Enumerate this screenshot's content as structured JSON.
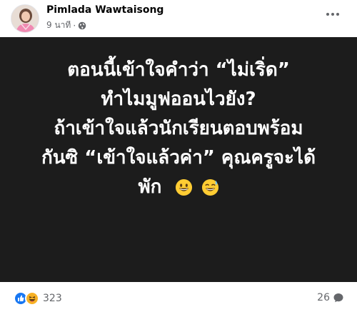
{
  "post": {
    "author": "Pimlada Wawtaisong",
    "time": "9 นาที",
    "separator": "·",
    "audience_icon": "globe-icon",
    "more_icon": "more-options-icon"
  },
  "image_text": {
    "lines": [
      "ตอนนี้เข้าใจคำว่า “ไม่เริ่ด”",
      "ทำไมมูฟออนไวยัง?",
      "ถ้าเข้าใจแล้วนักเรียนตอบพร้อม",
      "กันซิ “เข้าใจแล้วค่า” คุณครูจะได้",
      "พัก"
    ],
    "emojis": [
      "grinning-face-icon",
      "grinning-face-with-sweat-icon"
    ]
  },
  "footer": {
    "reaction_icons": [
      "like-icon",
      "haha-icon"
    ],
    "reaction_count": "323",
    "comment_count": "26",
    "comment_icon": "comment-icon"
  },
  "colors": {
    "image_background": "#1c1c1c",
    "like_blue": "#1877f2",
    "haha_yellow": "#f7b125",
    "secondary_text": "#65676b"
  }
}
